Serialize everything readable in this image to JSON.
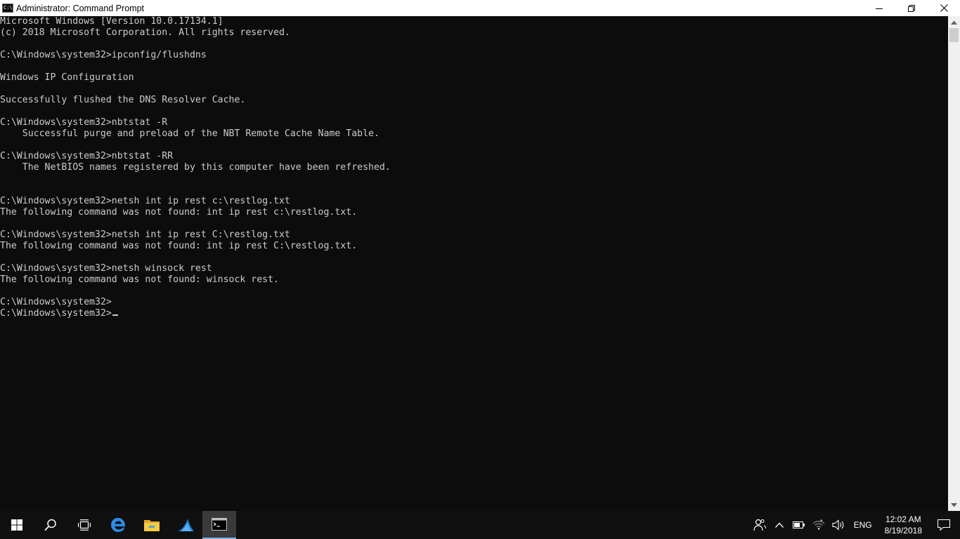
{
  "window": {
    "title": "Administrator: Command Prompt",
    "icon_text": "C:\\"
  },
  "console": {
    "lines": [
      "Microsoft Windows [Version 10.0.17134.1]",
      "(c) 2018 Microsoft Corporation. All rights reserved.",
      "",
      "C:\\Windows\\system32>ipconfig/flushdns",
      "",
      "Windows IP Configuration",
      "",
      "Successfully flushed the DNS Resolver Cache.",
      "",
      "C:\\Windows\\system32>nbtstat -R",
      "    Successful purge and preload of the NBT Remote Cache Name Table.",
      "",
      "C:\\Windows\\system32>nbtstat -RR",
      "    The NetBIOS names registered by this computer have been refreshed.",
      "",
      "",
      "C:\\Windows\\system32>netsh int ip rest c:\\restlog.txt",
      "The following command was not found: int ip rest c:\\restlog.txt.",
      "",
      "C:\\Windows\\system32>netsh int ip rest C:\\restlog.txt",
      "The following command was not found: int ip rest C:\\restlog.txt.",
      "",
      "C:\\Windows\\system32>netsh winsock rest",
      "The following command was not found: winsock rest.",
      "",
      "C:\\Windows\\system32>"
    ],
    "prompt": "C:\\Windows\\system32>"
  },
  "taskbar": {
    "pinned": [
      {
        "name": "start-icon"
      },
      {
        "name": "search-icon"
      },
      {
        "name": "task-view-icon"
      },
      {
        "name": "edge-icon"
      },
      {
        "name": "file-explorer-icon"
      },
      {
        "name": "wireshark-icon"
      },
      {
        "name": "command-prompt-icon",
        "active": true
      }
    ],
    "tray": {
      "language": "ENG",
      "time": "12:02 AM",
      "date": "8/19/2018"
    }
  },
  "colors": {
    "console_bg": "#0c0c0c",
    "console_fg": "#cccccc",
    "taskbar_bg": "#101010",
    "active_underline": "#7fb4e8"
  }
}
